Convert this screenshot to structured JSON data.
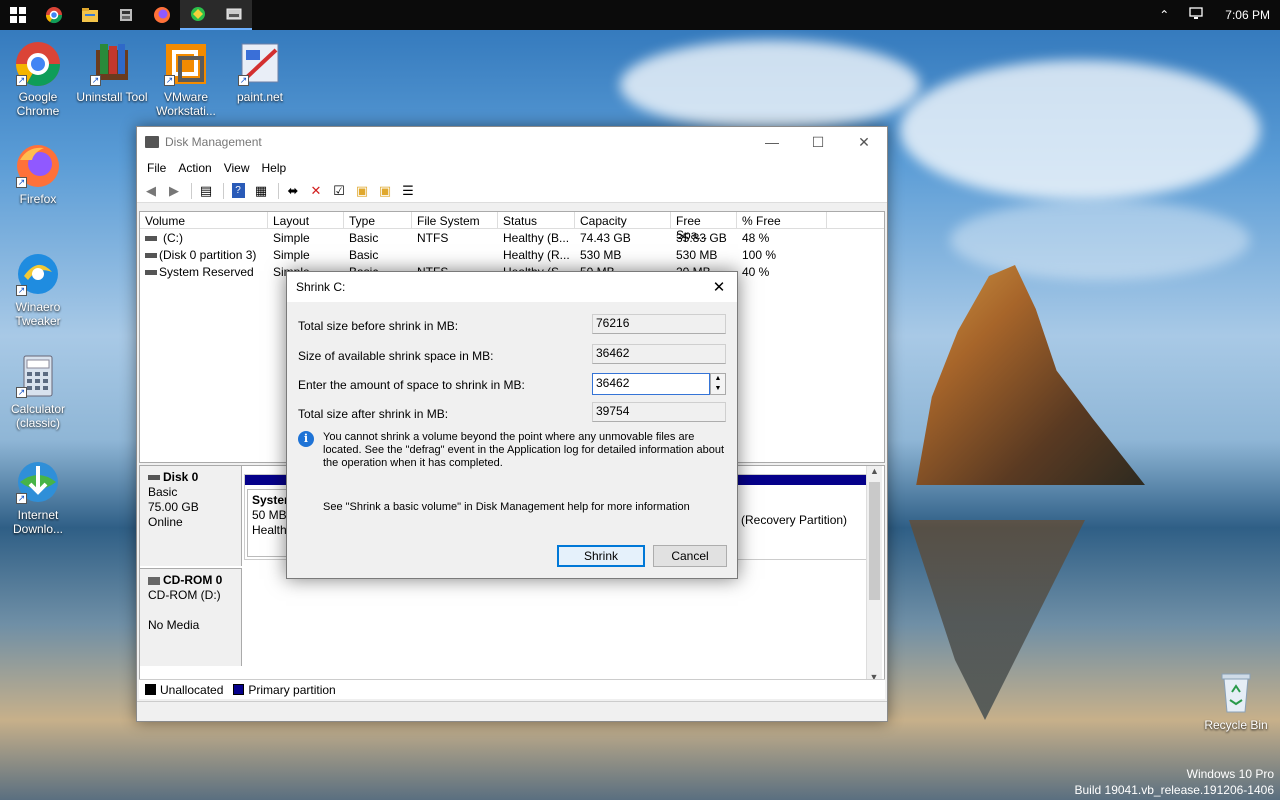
{
  "taskbar": {
    "time": "7:06 PM",
    "apps": [
      "start-button",
      "chrome-icon",
      "file-explorer-icon",
      "app-icon",
      "firefox-icon",
      "winaero-icon",
      "disk-management-icon"
    ]
  },
  "desktop": {
    "icons": [
      {
        "label": "Google Chrome"
      },
      {
        "label": "Uninstall Tool"
      },
      {
        "label": "VMware Workstati..."
      },
      {
        "label": "paint.net"
      },
      {
        "label": "Firefox"
      },
      {
        "label": "Winaero Tweaker"
      },
      {
        "label": "Calculator (classic)"
      },
      {
        "label": "Internet Downlo..."
      },
      {
        "label": "Recycle Bin"
      }
    ],
    "watermark_line1": "Windows 10 Pro",
    "watermark_line2": "Build 19041.vb_release.191206-1406"
  },
  "window": {
    "title": "Disk Management",
    "menu": [
      "File",
      "Action",
      "View",
      "Help"
    ],
    "columns": [
      "Volume",
      "Layout",
      "Type",
      "File System",
      "Status",
      "Capacity",
      "Free Spa...",
      "% Free"
    ],
    "rows": [
      [
        "(C:)",
        "Simple",
        "Basic",
        "NTFS",
        "Healthy (B...",
        "74.43 GB",
        "35.83 GB",
        "48 %"
      ],
      [
        "(Disk 0 partition 3)",
        "Simple",
        "Basic",
        "",
        "Healthy (R...",
        "530 MB",
        "530 MB",
        "100 %"
      ],
      [
        "System Reserved",
        "Simple",
        "Basic",
        "NTFS",
        "Healthy (S...",
        "50 MB",
        "20 MB",
        "40 %"
      ]
    ],
    "disk0": {
      "name": "Disk 0",
      "type": "Basic",
      "size": "75.00 GB",
      "state": "Online",
      "part1_name": "System",
      "part1_size": "50 MB",
      "part1_status": "Healthy",
      "part3_status": "(Recovery Partition)"
    },
    "cdrom": {
      "name": "CD-ROM 0",
      "type": "CD-ROM (D:)",
      "media": "No Media"
    },
    "legend": {
      "unallocated": "Unallocated",
      "primary": "Primary partition"
    }
  },
  "dialog": {
    "title": "Shrink C:",
    "label_total_before": "Total size before shrink in MB:",
    "value_total_before": "76216",
    "label_available": "Size of available shrink space in MB:",
    "value_available": "36462",
    "label_amount": "Enter the amount of space to shrink in MB:",
    "value_amount": "36462",
    "label_total_after": "Total size after shrink in MB:",
    "value_total_after": "39754",
    "info_text": "You cannot shrink a volume beyond the point where any unmovable files are located. See the \"defrag\" event in the Application log for detailed information about the operation when it has completed.",
    "help_text": "See \"Shrink a basic volume\" in Disk Management help for more information",
    "shrink_label": "Shrink",
    "cancel_label": "Cancel"
  },
  "colors": {
    "primary_partition": "#05008a",
    "accent": "#0078d7"
  }
}
